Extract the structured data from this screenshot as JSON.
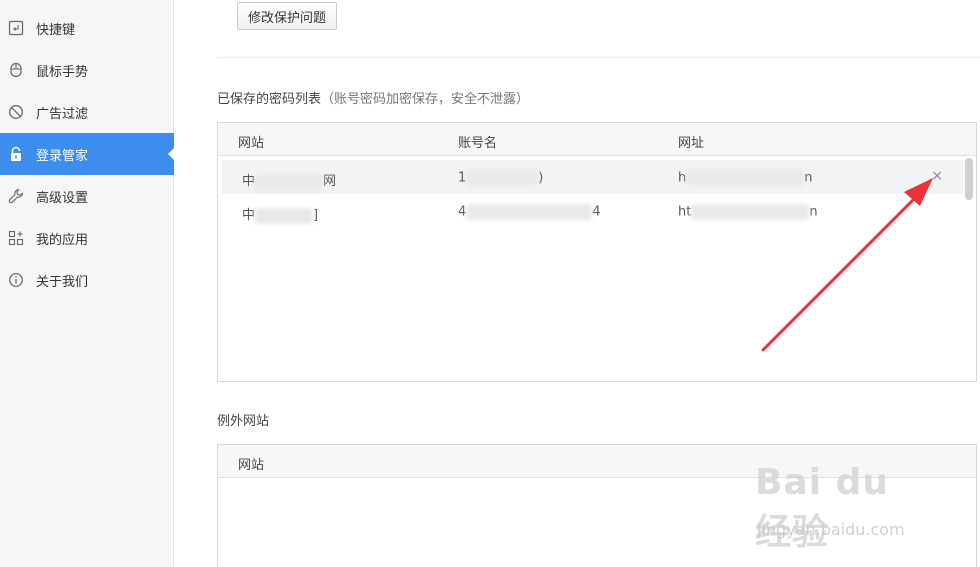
{
  "sidebar": {
    "items": [
      {
        "label": "快捷键",
        "icon": "keyboard-icon"
      },
      {
        "label": "鼠标手势",
        "icon": "mouse-icon"
      },
      {
        "label": "广告过滤",
        "icon": "ban-icon"
      },
      {
        "label": "登录管家",
        "icon": "lock-icon"
      },
      {
        "label": "高级设置",
        "icon": "wrench-icon"
      },
      {
        "label": "我的应用",
        "icon": "apps-icon"
      },
      {
        "label": "关于我们",
        "icon": "info-icon"
      }
    ],
    "active_index": 3
  },
  "main": {
    "modify_button": "修改保护问题",
    "saved_title": "已保存的密码列表",
    "saved_hint": "（账号密码加密保存，安全不泄露）",
    "saved_columns": [
      "网站",
      "账号名",
      "网址"
    ],
    "saved_rows": [
      {
        "site": [
          "中",
          "网"
        ],
        "account": [
          "1",
          ")"
        ],
        "url": [
          "h",
          "n"
        ]
      },
      {
        "site": [
          "中",
          "]"
        ],
        "account": [
          "4",
          "4"
        ],
        "url": [
          "ht",
          "n"
        ]
      }
    ],
    "delete_glyph": "×",
    "exception_title": "例外网站",
    "exception_columns": [
      "网站"
    ]
  },
  "watermark": {
    "main": "Bai du 经验",
    "sub": "jingyan.baidu.com"
  },
  "colors": {
    "accent": "#3c8ded",
    "arrow": "#e8333a"
  }
}
